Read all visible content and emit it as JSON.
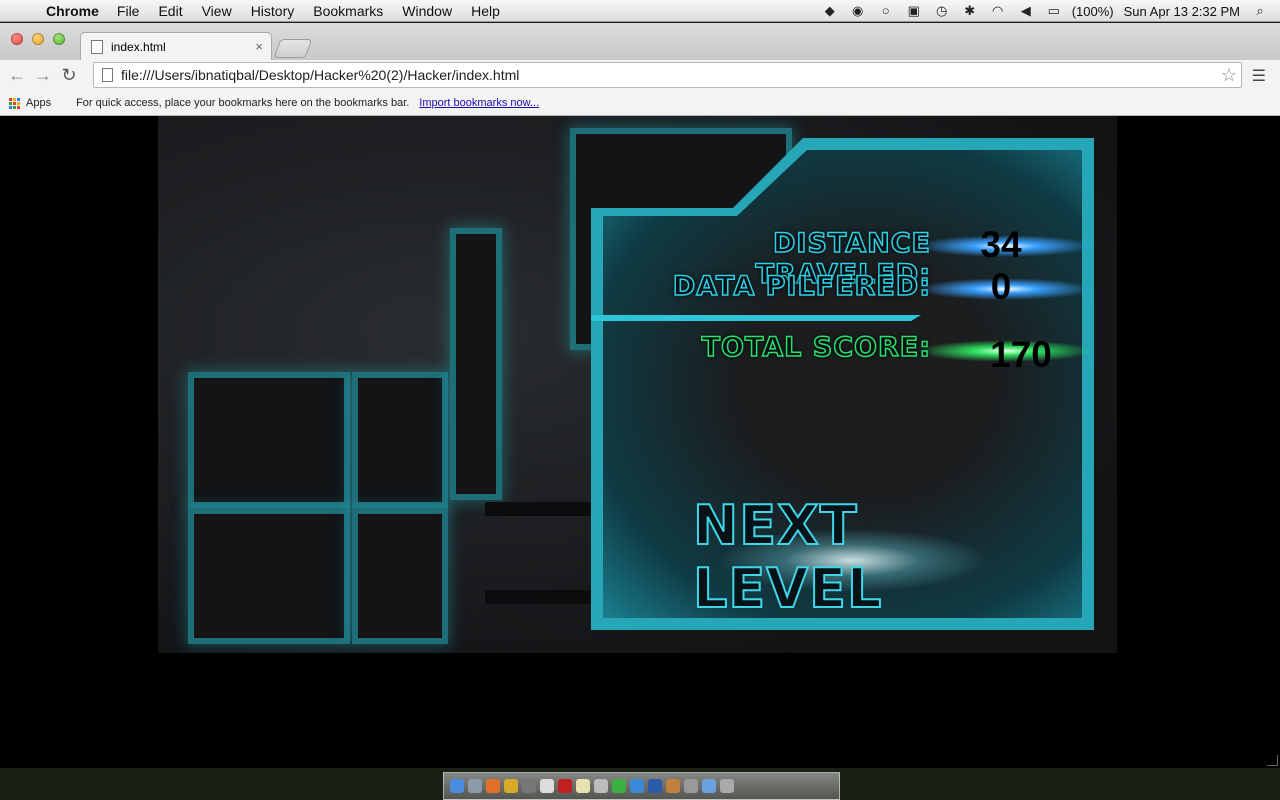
{
  "menubar": {
    "app_name": "Chrome",
    "items": [
      "File",
      "Edit",
      "View",
      "History",
      "Bookmarks",
      "Window",
      "Help"
    ],
    "battery": "(100%)",
    "clock": "Sun Apr 13  2:32 PM"
  },
  "browser": {
    "tab_title": "index.html",
    "tab_close": "×",
    "url": "file:///Users/ibnatiqbal/Desktop/Hacker%20(2)/Hacker/index.html",
    "bookmarks_apps": "Apps",
    "bookmarks_hint": "For quick access, place your bookmarks here on the bookmarks bar.",
    "bookmarks_import": "Import bookmarks now..."
  },
  "game": {
    "distance_label": "DISTANCE TRAVELED:",
    "distance_value": "34",
    "data_label": "DATA PILFERED:",
    "data_value": "0",
    "total_label": "TOTAL SCORE:",
    "total_value": "170",
    "next_level_label": "NEXT LEVEL"
  },
  "colors": {
    "panel_accent": "#27a6b8",
    "label_outline": "#2fd1e6",
    "score_outline_green": "#28e06a"
  }
}
